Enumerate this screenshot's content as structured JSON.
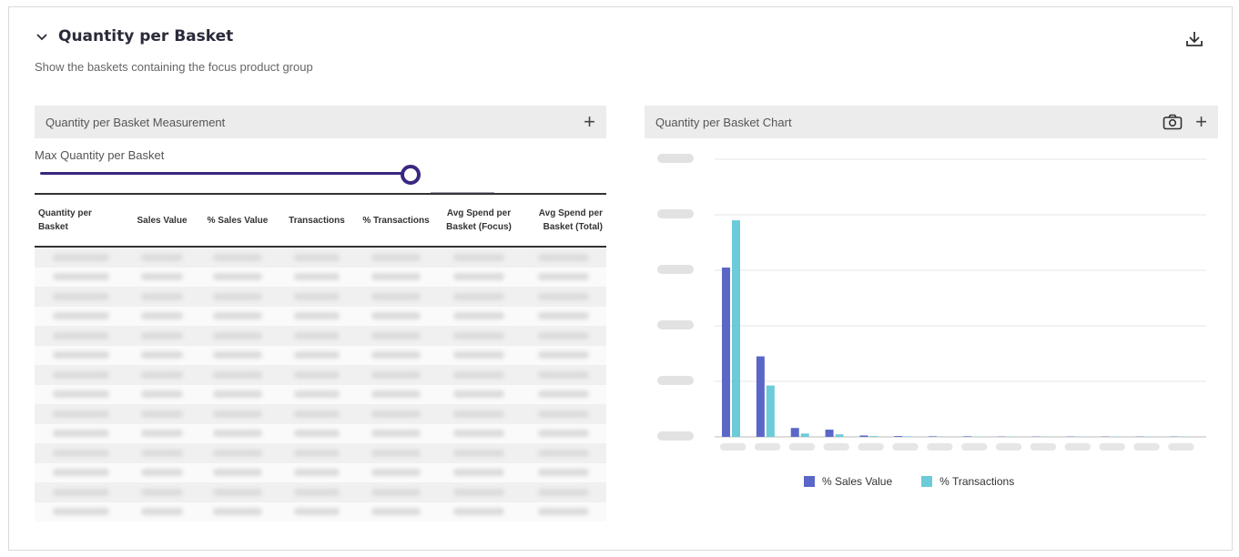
{
  "header": {
    "title": "Quantity per Basket",
    "subtitle": "Show the baskets containing the focus product group",
    "collapse_icon": "chevron-down-icon",
    "download_icon": "download-icon"
  },
  "left_panel": {
    "title": "Quantity per Basket Measurement",
    "add_label": "+",
    "slider_label": "Max Quantity per Basket",
    "slider_level": 1.0,
    "columns": [
      "Quantity per Basket",
      "Sales Value",
      "% Sales Value",
      "Transactions",
      "% Transactions",
      "Avg Spend per Basket (Focus)",
      "Avg Spend per Basket (Total)"
    ],
    "row_count": 14
  },
  "right_panel": {
    "title": "Quantity per Basket Chart",
    "add_label": "+",
    "camera_icon": "camera-icon"
  },
  "colors": {
    "accent": "#3a2780",
    "sales_value": "#5b67c7",
    "transactions": "#6ccbd8"
  },
  "chart_data": {
    "type": "bar",
    "categories": [
      "",
      "",
      "",
      "",
      "",
      "",
      "",
      "",
      "",
      "",
      "",
      "",
      "",
      ""
    ],
    "series": [
      {
        "name": "% Sales Value",
        "values": [
          61,
          29,
          3.2,
          2.6,
          0.5,
          0.3,
          0.2,
          0.2,
          0.1,
          0.1,
          0.1,
          0.1,
          0.1,
          0.1
        ]
      },
      {
        "name": "% Transactions",
        "values": [
          78,
          18.5,
          1.2,
          0.9,
          0.3,
          0.2,
          0.1,
          0.1,
          0.1,
          0.1,
          0.1,
          0.1,
          0.1,
          0.1
        ]
      }
    ],
    "ylim": [
      0,
      100
    ],
    "grid": true,
    "legend": "bottom"
  }
}
